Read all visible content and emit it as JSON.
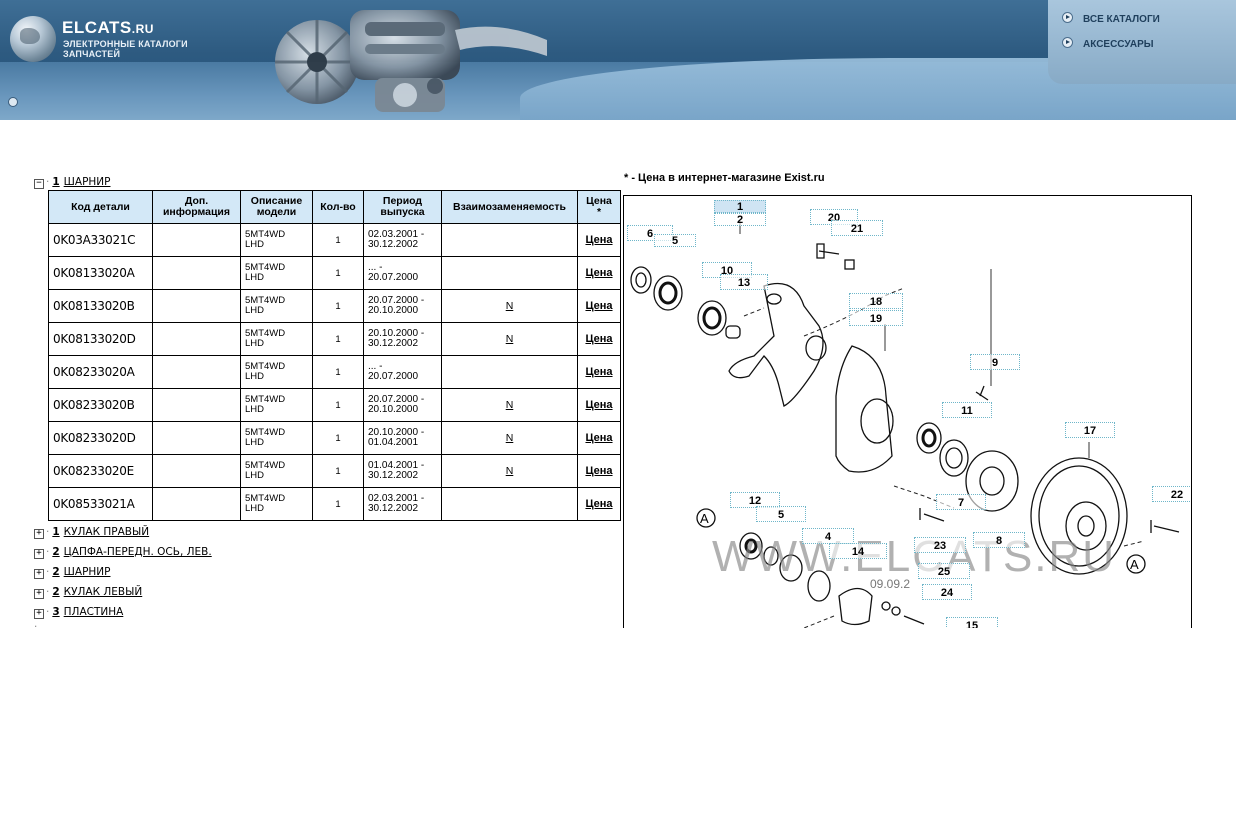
{
  "header": {
    "brand": "ELCATS",
    "brand_suffix": ".RU",
    "subtitle_line1": "ЭЛЕКТРОННЫЕ КАТАЛОГИ",
    "subtitle_line2": "ЗАПЧАСТЕЙ",
    "nav": [
      {
        "label": "ВСЕ КАТАЛОГИ"
      },
      {
        "label": "АКСЕССУАРЫ"
      }
    ]
  },
  "tree": {
    "expanded": {
      "toggle": "−",
      "number": "1",
      "label": "ШАРНИР"
    },
    "collapsed": [
      {
        "toggle": "+",
        "number": "1",
        "label": "КУЛАК ПРАВЫЙ"
      },
      {
        "toggle": "+",
        "number": "2",
        "label": "ЦАПФА-ПЕРЕДН. ОСЬ, ЛЕВ."
      },
      {
        "toggle": "+",
        "number": "2",
        "label": "ШАРНИР"
      },
      {
        "toggle": "+",
        "number": "2",
        "label": "КУЛАК ЛЕВЫЙ"
      },
      {
        "toggle": "+",
        "number": "3",
        "label": "ПЛАСТИНА"
      }
    ]
  },
  "table": {
    "headers": {
      "code": "Код детали",
      "info_1": "Доп.",
      "info_2": "информация",
      "desc_1": "Описание",
      "desc_2": "модели",
      "qty": "Кол-во",
      "period_1": "Период",
      "period_2": "выпуска",
      "interchange": "Взаимозаменяемость",
      "price_1": "Цена",
      "price_2": "*"
    },
    "rows": [
      {
        "code": "0K03A33021C",
        "info": "",
        "desc_1": "5MT4WD",
        "desc_2": "LHD",
        "qty": "1",
        "period_1": "02.03.2001 -",
        "period_2": "30.12.2002",
        "interchange": "",
        "price": "Цена"
      },
      {
        "code": "0K08133020A",
        "info": "",
        "desc_1": "5MT4WD",
        "desc_2": "LHD",
        "qty": "1",
        "period_1": "... -",
        "period_2": "20.07.2000",
        "interchange": "",
        "price": "Цена"
      },
      {
        "code": "0K08133020B",
        "info": "",
        "desc_1": "5MT4WD",
        "desc_2": "LHD",
        "qty": "1",
        "period_1": "20.07.2000 -",
        "period_2": "20.10.2000",
        "interchange": "N",
        "price": "Цена"
      },
      {
        "code": "0K08133020D",
        "info": "",
        "desc_1": "5MT4WD",
        "desc_2": "LHD",
        "qty": "1",
        "period_1": "20.10.2000 -",
        "period_2": "30.12.2002",
        "interchange": "N",
        "price": "Цена"
      },
      {
        "code": "0K08233020A",
        "info": "",
        "desc_1": "5MT4WD",
        "desc_2": "LHD",
        "qty": "1",
        "period_1": "... -",
        "period_2": "20.07.2000",
        "interchange": "",
        "price": "Цена"
      },
      {
        "code": "0K08233020B",
        "info": "",
        "desc_1": "5MT4WD",
        "desc_2": "LHD",
        "qty": "1",
        "period_1": "20.07.2000 -",
        "period_2": "20.10.2000",
        "interchange": "N",
        "price": "Цена"
      },
      {
        "code": "0K08233020D",
        "info": "",
        "desc_1": "5MT4WD",
        "desc_2": "LHD",
        "qty": "1",
        "period_1": "20.10.2000 -",
        "period_2": "01.04.2001",
        "interchange": "N",
        "price": "Цена"
      },
      {
        "code": "0K08233020E",
        "info": "",
        "desc_1": "5MT4WD",
        "desc_2": "LHD",
        "qty": "1",
        "period_1": "01.04.2001 -",
        "period_2": "30.12.2002",
        "interchange": "N",
        "price": "Цена"
      },
      {
        "code": "0K08533021A",
        "info": "",
        "desc_1": "5MT4WD",
        "desc_2": "LHD",
        "qty": "1",
        "period_1": "02.03.2001 -",
        "period_2": "30.12.2002",
        "interchange": "",
        "price": "Цена"
      }
    ]
  },
  "exist_note": "* - Цена в интернет-магазине Exist.ru",
  "diagram": {
    "watermark": "WWW.ELCATS.RU",
    "date_fragment": "09.09.2",
    "callouts": [
      "1",
      "2",
      "6",
      "5",
      "20",
      "21",
      "10",
      "13",
      "18",
      "19",
      "9",
      "11",
      "17",
      "12",
      "5",
      "4",
      "14",
      "7",
      "23",
      "8",
      "22",
      "25",
      "24",
      "15"
    ],
    "ref_letter": "A"
  },
  "colors": {
    "header_bg": "#2d5a80",
    "table_header_bg": "#d3e8f7",
    "callout_border": "#6fb6c9",
    "selected_callout_bg": "#cfe4f3"
  }
}
